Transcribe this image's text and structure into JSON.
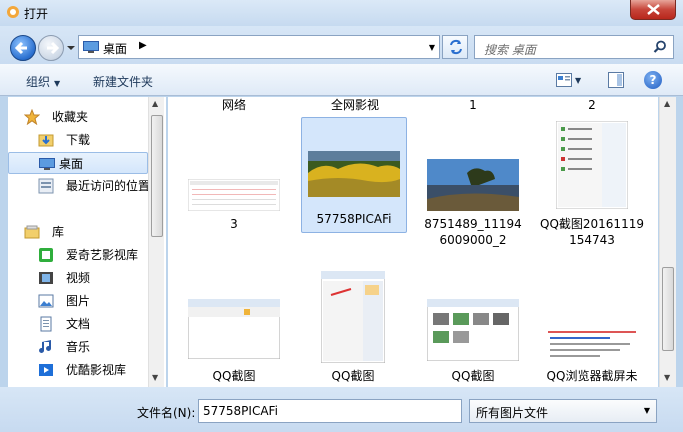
{
  "window": {
    "title": "打开",
    "close_label": "✕"
  },
  "address": {
    "location": "桌面",
    "search_placeholder": "搜索 桌面"
  },
  "toolbar": {
    "organize": "组织",
    "new_folder": "新建文件夹"
  },
  "nav": {
    "items": [
      {
        "label": "收藏夹",
        "icon": "star-icon"
      },
      {
        "label": "下载",
        "icon": "download-folder-icon"
      },
      {
        "label": "桌面",
        "icon": "desktop-icon",
        "selected": true
      },
      {
        "label": "最近访问的位置",
        "icon": "recent-places-icon"
      },
      {
        "label": "库",
        "icon": "library-icon"
      },
      {
        "label": "爱奇艺影视库",
        "icon": "iqiyi-icon"
      },
      {
        "label": "视频",
        "icon": "video-library-icon"
      },
      {
        "label": "图片",
        "icon": "picture-library-icon"
      },
      {
        "label": "文档",
        "icon": "document-library-icon"
      },
      {
        "label": "音乐",
        "icon": "music-library-icon"
      },
      {
        "label": "优酷影视库",
        "icon": "youku-icon"
      }
    ]
  },
  "files": {
    "top_row": [
      "网络",
      "全网影视",
      "1",
      "2"
    ],
    "row1": [
      {
        "name": "3"
      },
      {
        "name": "57758PICAFi",
        "selected": true
      },
      {
        "name": "8751489_111946009000_2"
      },
      {
        "name": "QQ截图20161119154743"
      }
    ],
    "row2": [
      {
        "name": "QQ截图"
      },
      {
        "name": "QQ截图"
      },
      {
        "name": "QQ截图"
      },
      {
        "name": "QQ浏览器截屏未"
      }
    ]
  },
  "bottom": {
    "filename_label": "文件名(N):",
    "filename_value": "57758PICAFi",
    "filetype_value": "所有图片文件"
  },
  "colors": {
    "accent": "#3c7fd0",
    "selection": "#d4e6fb"
  }
}
